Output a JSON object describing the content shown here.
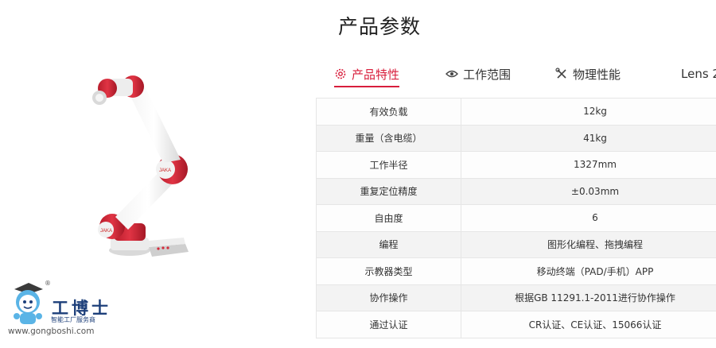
{
  "page": {
    "title": "产品参数"
  },
  "tabs": [
    {
      "label": "产品特性",
      "icon": "gear-icon",
      "active": true
    },
    {
      "label": "工作范围",
      "icon": "eye-icon",
      "active": false
    },
    {
      "label": "物理性能",
      "icon": "tools-icon",
      "active": false
    },
    {
      "label": "Lens 2",
      "icon": "",
      "active": false
    }
  ],
  "specs": [
    {
      "label": "有效负载",
      "value": "12kg"
    },
    {
      "label": "重量（含电缆）",
      "value": "41kg"
    },
    {
      "label": "工作半径",
      "value": "1327mm"
    },
    {
      "label": "重复定位精度",
      "value": "±0.03mm"
    },
    {
      "label": "自由度",
      "value": "6"
    },
    {
      "label": "编程",
      "value": "图形化编程、拖拽编程"
    },
    {
      "label": "示教器类型",
      "value": "移动终端（PAD/手机）APP"
    },
    {
      "label": "协作操作",
      "value": "根据GB 11291.1-2011进行协作操作"
    },
    {
      "label": "通过认证",
      "value": "CR认证、CE认证、15066认证"
    }
  ],
  "watermark": {
    "name": "工博士",
    "tagline": "智能工厂服务商",
    "url": "www.gongboshi.com",
    "registered": "®"
  },
  "colors": {
    "accent": "#d81e3c",
    "robot_red": "#d42a3a",
    "logo_blue": "#1d3f7a"
  }
}
